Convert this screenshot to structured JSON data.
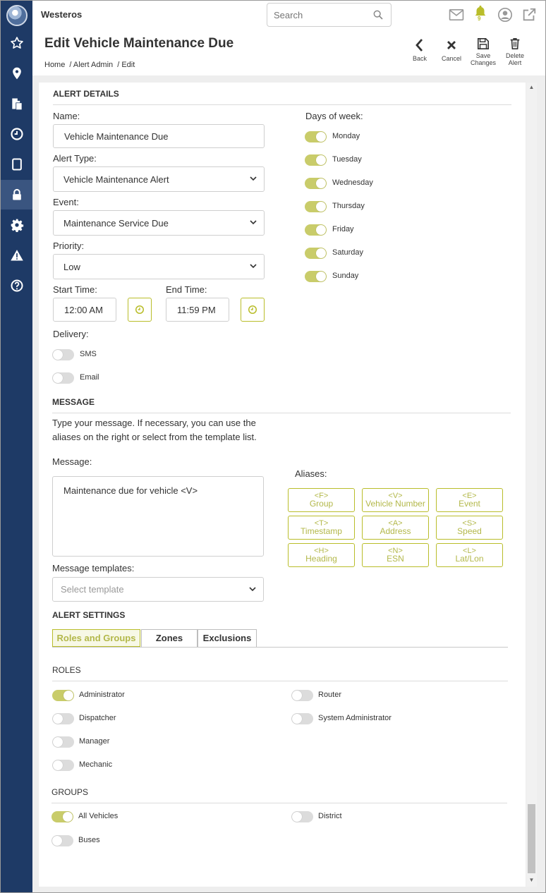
{
  "app": {
    "brand": "Westeros"
  },
  "search": {
    "placeholder": "Search"
  },
  "notifications": {
    "count": "9"
  },
  "header": {
    "title": "Edit Vehicle Maintenance Due",
    "breadcrumb": [
      "Home",
      "/ Alert Admin",
      "/ Edit"
    ],
    "actions": {
      "back": "Back",
      "cancel": "Cancel",
      "save": [
        "Save",
        "Changes"
      ],
      "delete": [
        "Delete",
        "Alert"
      ]
    }
  },
  "sidebar": {
    "icons": [
      "star-icon",
      "map-pin-icon",
      "documents-icon",
      "clock-icon",
      "tablet-icon",
      "lock-icon",
      "gear-icon",
      "warning-icon",
      "help-icon"
    ],
    "active": "lock-icon"
  },
  "alert_details": {
    "title": "ALERT DETAILS",
    "name_label": "Name:",
    "name_value": "Vehicle Maintenance Due",
    "type_label": "Alert Type:",
    "type_value": "Vehicle Maintenance Alert",
    "event_label": "Event:",
    "event_value": "Maintenance Service Due",
    "priority_label": "Priority:",
    "priority_value": "Low",
    "start_label": "Start Time:",
    "start_value": "12:00 AM",
    "end_label": "End Time:",
    "end_value": "11:59 PM",
    "delivery_label": "Delivery:",
    "delivery": [
      {
        "label": "SMS",
        "on": false
      },
      {
        "label": "Email",
        "on": false
      }
    ],
    "days_label": "Days of week:",
    "days": [
      {
        "label": "Monday",
        "on": true
      },
      {
        "label": "Tuesday",
        "on": true
      },
      {
        "label": "Wednesday",
        "on": true
      },
      {
        "label": "Thursday",
        "on": true
      },
      {
        "label": "Friday",
        "on": true
      },
      {
        "label": "Saturday",
        "on": true
      },
      {
        "label": "Sunday",
        "on": true
      }
    ]
  },
  "message": {
    "title": "MESSAGE",
    "help": "Type your message. If necessary, you can use the aliases on the right or select from the template list.",
    "message_label": "Message:",
    "message_value": "Maintenance due for vehicle <V>",
    "templates_label": "Message templates:",
    "templates_placeholder": "Select template",
    "aliases_label": "Aliases:",
    "aliases": [
      {
        "code": "<F>",
        "name": "Group"
      },
      {
        "code": "<V>",
        "name": "Vehicle Number"
      },
      {
        "code": "<E>",
        "name": "Event"
      },
      {
        "code": "<T>",
        "name": "Timestamp"
      },
      {
        "code": "<A>",
        "name": "Address"
      },
      {
        "code": "<S>",
        "name": "Speed"
      },
      {
        "code": "<H>",
        "name": "Heading"
      },
      {
        "code": "<N>",
        "name": "ESN"
      },
      {
        "code": "<L>",
        "name": "Lat/Lon"
      }
    ]
  },
  "alert_settings": {
    "title": "ALERT SETTINGS",
    "tabs": [
      "Roles and Groups",
      "Zones",
      "Exclusions"
    ],
    "active_tab": "Roles and Groups",
    "roles_title": "ROLES",
    "roles": [
      {
        "label": "Administrator",
        "on": true
      },
      {
        "label": "Router",
        "on": false
      },
      {
        "label": "Dispatcher",
        "on": false
      },
      {
        "label": "System Administrator",
        "on": false
      },
      {
        "label": "Manager",
        "on": false
      },
      {
        "label": "Mechanic",
        "on": false
      }
    ],
    "groups_title": "GROUPS",
    "groups": [
      {
        "label": "All Vehicles",
        "on": true
      },
      {
        "label": "District",
        "on": false
      },
      {
        "label": "Buses",
        "on": false
      }
    ]
  },
  "colors": {
    "sidebar": "#1e3a66",
    "accent": "#b9bd2a",
    "toggle_on": "#c9cc6a"
  }
}
